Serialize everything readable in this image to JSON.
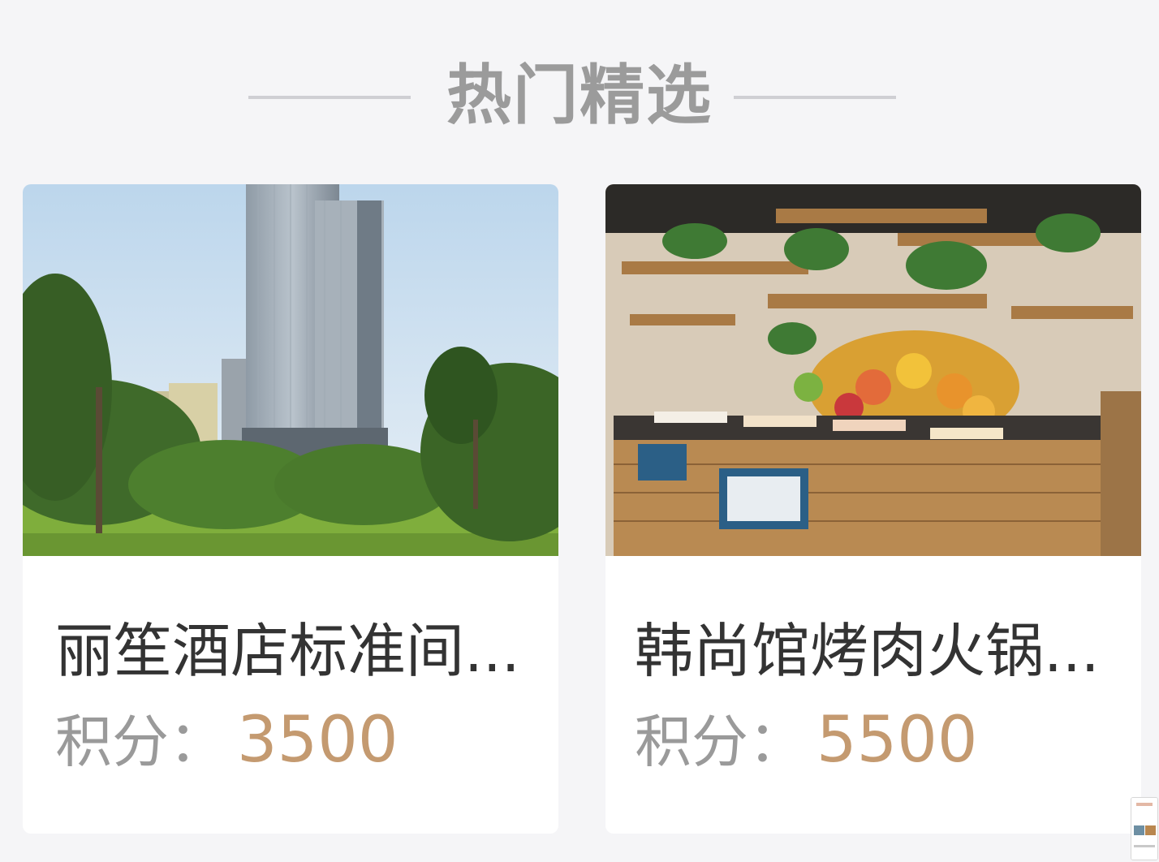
{
  "section": {
    "title": "热门精选"
  },
  "products": [
    {
      "title": "丽笙酒店标准间...",
      "price_label": "积分：",
      "price_value": "3500",
      "image_icon": "hotel-photo"
    },
    {
      "title": "韩尚馆烤肉火锅...",
      "price_label": "积分：",
      "price_value": "5500",
      "image_icon": "buffet-photo"
    }
  ],
  "colors": {
    "background": "#f5f5f7",
    "card": "#ffffff",
    "title_gray": "#9b9b9b",
    "text_dark": "#333333",
    "label_gray": "#9a9a9a",
    "price_gold": "#c49a70"
  }
}
